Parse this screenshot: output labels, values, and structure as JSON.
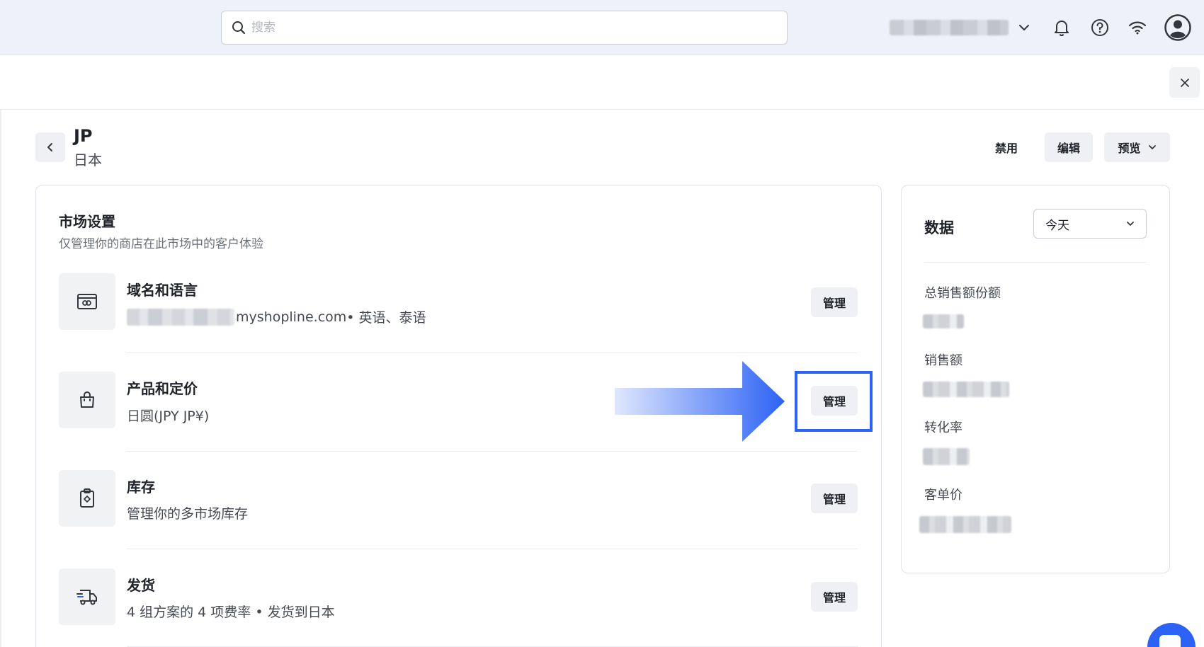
{
  "topbar": {
    "search_placeholder": "搜索",
    "icons": [
      "search-icon",
      "chevron-down-icon",
      "bell-icon",
      "help-icon",
      "wifi-icon",
      "avatar-icon"
    ]
  },
  "header": {
    "title": "JP",
    "subtitle": "日本",
    "disable_label": "禁用",
    "edit_label": "编辑",
    "preview_label": "预览"
  },
  "market_settings": {
    "title": "市场设置",
    "description": "仅管理你的商店在此市场中的客户体验",
    "rows": [
      {
        "title": "域名和语言",
        "desc_domain": "myshopline.com",
        "desc_suffix": " • 英语、泰语",
        "button": "管理",
        "icon": "link-card-icon"
      },
      {
        "title": "产品和定价",
        "desc": "日圆(JPY JP¥)",
        "button": "管理",
        "icon": "shopping-bag-icon"
      },
      {
        "title": "库存",
        "desc": "管理你的多市场库存",
        "button": "管理",
        "icon": "clipboard-icon"
      },
      {
        "title": "发货",
        "desc": "4 组方案的 4 项费率 • 发货到日本",
        "button": "管理",
        "icon": "truck-icon"
      }
    ]
  },
  "data_panel": {
    "title": "数据",
    "range_selected": "今天",
    "metrics": [
      "总销售额份额",
      "销售额",
      "转化率",
      "客单价"
    ]
  },
  "colors": {
    "accent": "#2c62f5",
    "topbar_bg": "#eef1fa",
    "button_bg": "#eef0f3"
  }
}
